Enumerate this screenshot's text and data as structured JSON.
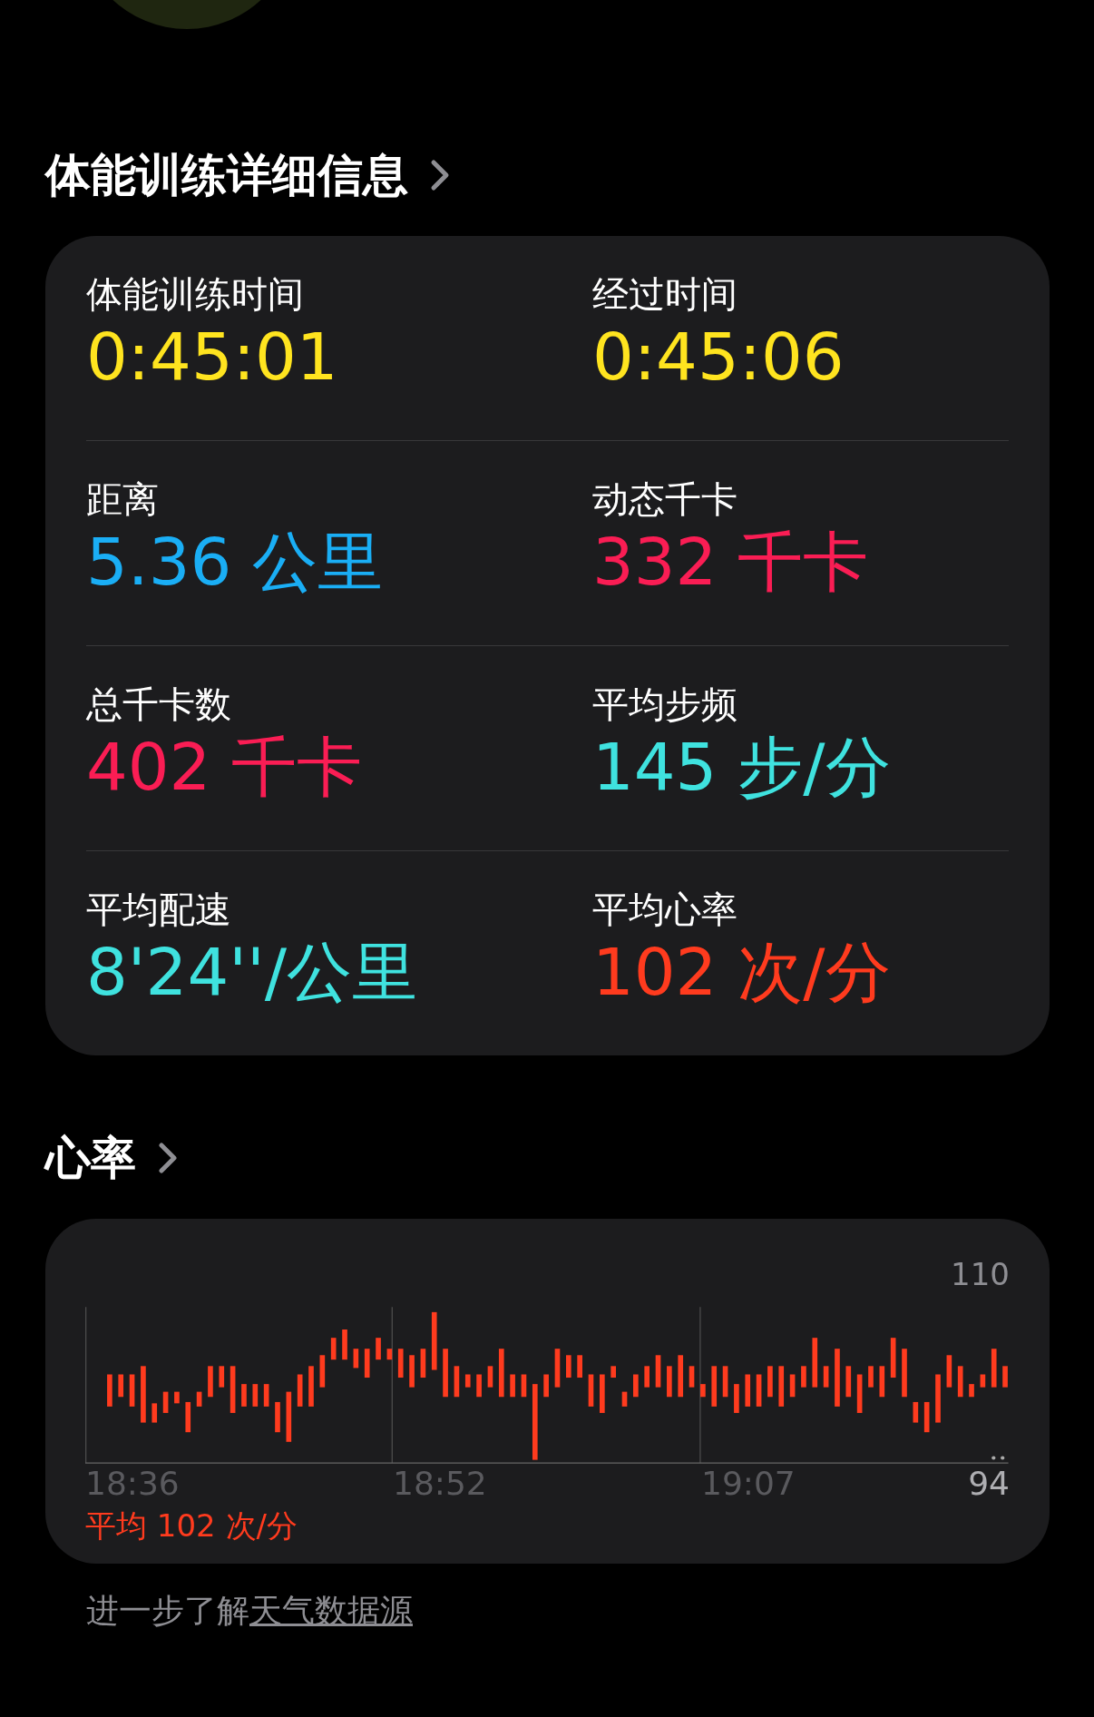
{
  "details": {
    "title": "体能训练详细信息",
    "metrics": [
      {
        "label": "体能训练时间",
        "value": "0:45:01",
        "color": "#ffe41f"
      },
      {
        "label": "经过时间",
        "value": "0:45:06",
        "color": "#ffe41f"
      },
      {
        "label": "距离",
        "value": "5.36 公里",
        "color": "#1aaef5"
      },
      {
        "label": "动态千卡",
        "value": "332 千卡",
        "color": "#fa1d54"
      },
      {
        "label": "总千卡数",
        "value": "402 千卡",
        "color": "#fa1d54"
      },
      {
        "label": "平均步频",
        "value": "145 步/分",
        "color": "#3fe2df"
      },
      {
        "label": "平均配速",
        "value": "8'24''/公里",
        "color": "#3fe2df"
      },
      {
        "label": "平均心率",
        "value": "102 次/分",
        "color": "#ff3b1e"
      }
    ]
  },
  "heart_rate": {
    "title": "心率",
    "y_max": "110",
    "y_min": "94",
    "x_labels": [
      "18:36",
      "18:52",
      "19:07"
    ],
    "average": "平均 102 次/分"
  },
  "footer": {
    "text": "进一步了解",
    "link": "天气数据源"
  }
}
